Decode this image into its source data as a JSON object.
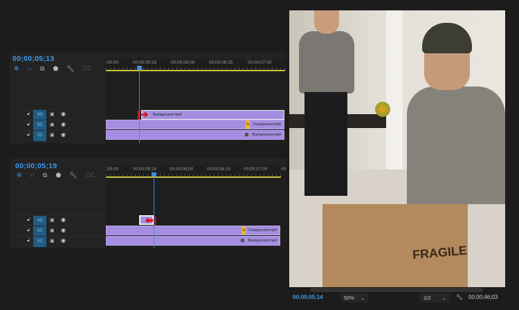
{
  "timelines": [
    {
      "timecode": "00;00;05;13",
      "ruler": [
        ";05;00",
        "00;00;05;15",
        "00;00;06;00",
        "00;00;06;15",
        "00;00;07;00"
      ],
      "tracks": [
        {
          "label": "V3",
          "clip": "Background.mp4"
        },
        {
          "label": "V2",
          "clip": "Foreground.mp4"
        },
        {
          "label": "V1",
          "clip": "Background.mp4"
        }
      ]
    },
    {
      "timecode": "00;00;05;19",
      "ruler": [
        ";05;00",
        "00;00;05;15",
        "00;00;06;00",
        "00;00;06;15",
        "00;00;07;00",
        "00"
      ],
      "tracks": [
        {
          "label": "V3",
          "clip": ""
        },
        {
          "label": "V2",
          "clip": "Foreground.mp4"
        },
        {
          "label": "V1",
          "clip": "Background.mp4"
        }
      ]
    }
  ],
  "toolbar_icons": [
    "snap-icon",
    "magnet-icon",
    "linked-selection-icon",
    "marker-icon",
    "wrench-icon",
    "captions-icon"
  ],
  "fx_badge": "fx",
  "monitor": {
    "timecode": "00;00;05;14",
    "zoom": "50%",
    "resolution": "1/2",
    "duration": "00;00;46;03",
    "box_text": "FRAGILE"
  },
  "colors": {
    "accent": "#3d9bea",
    "clip": "#a58ee0",
    "track_active": "#1f5c86",
    "work_area": "#c8c33a"
  }
}
